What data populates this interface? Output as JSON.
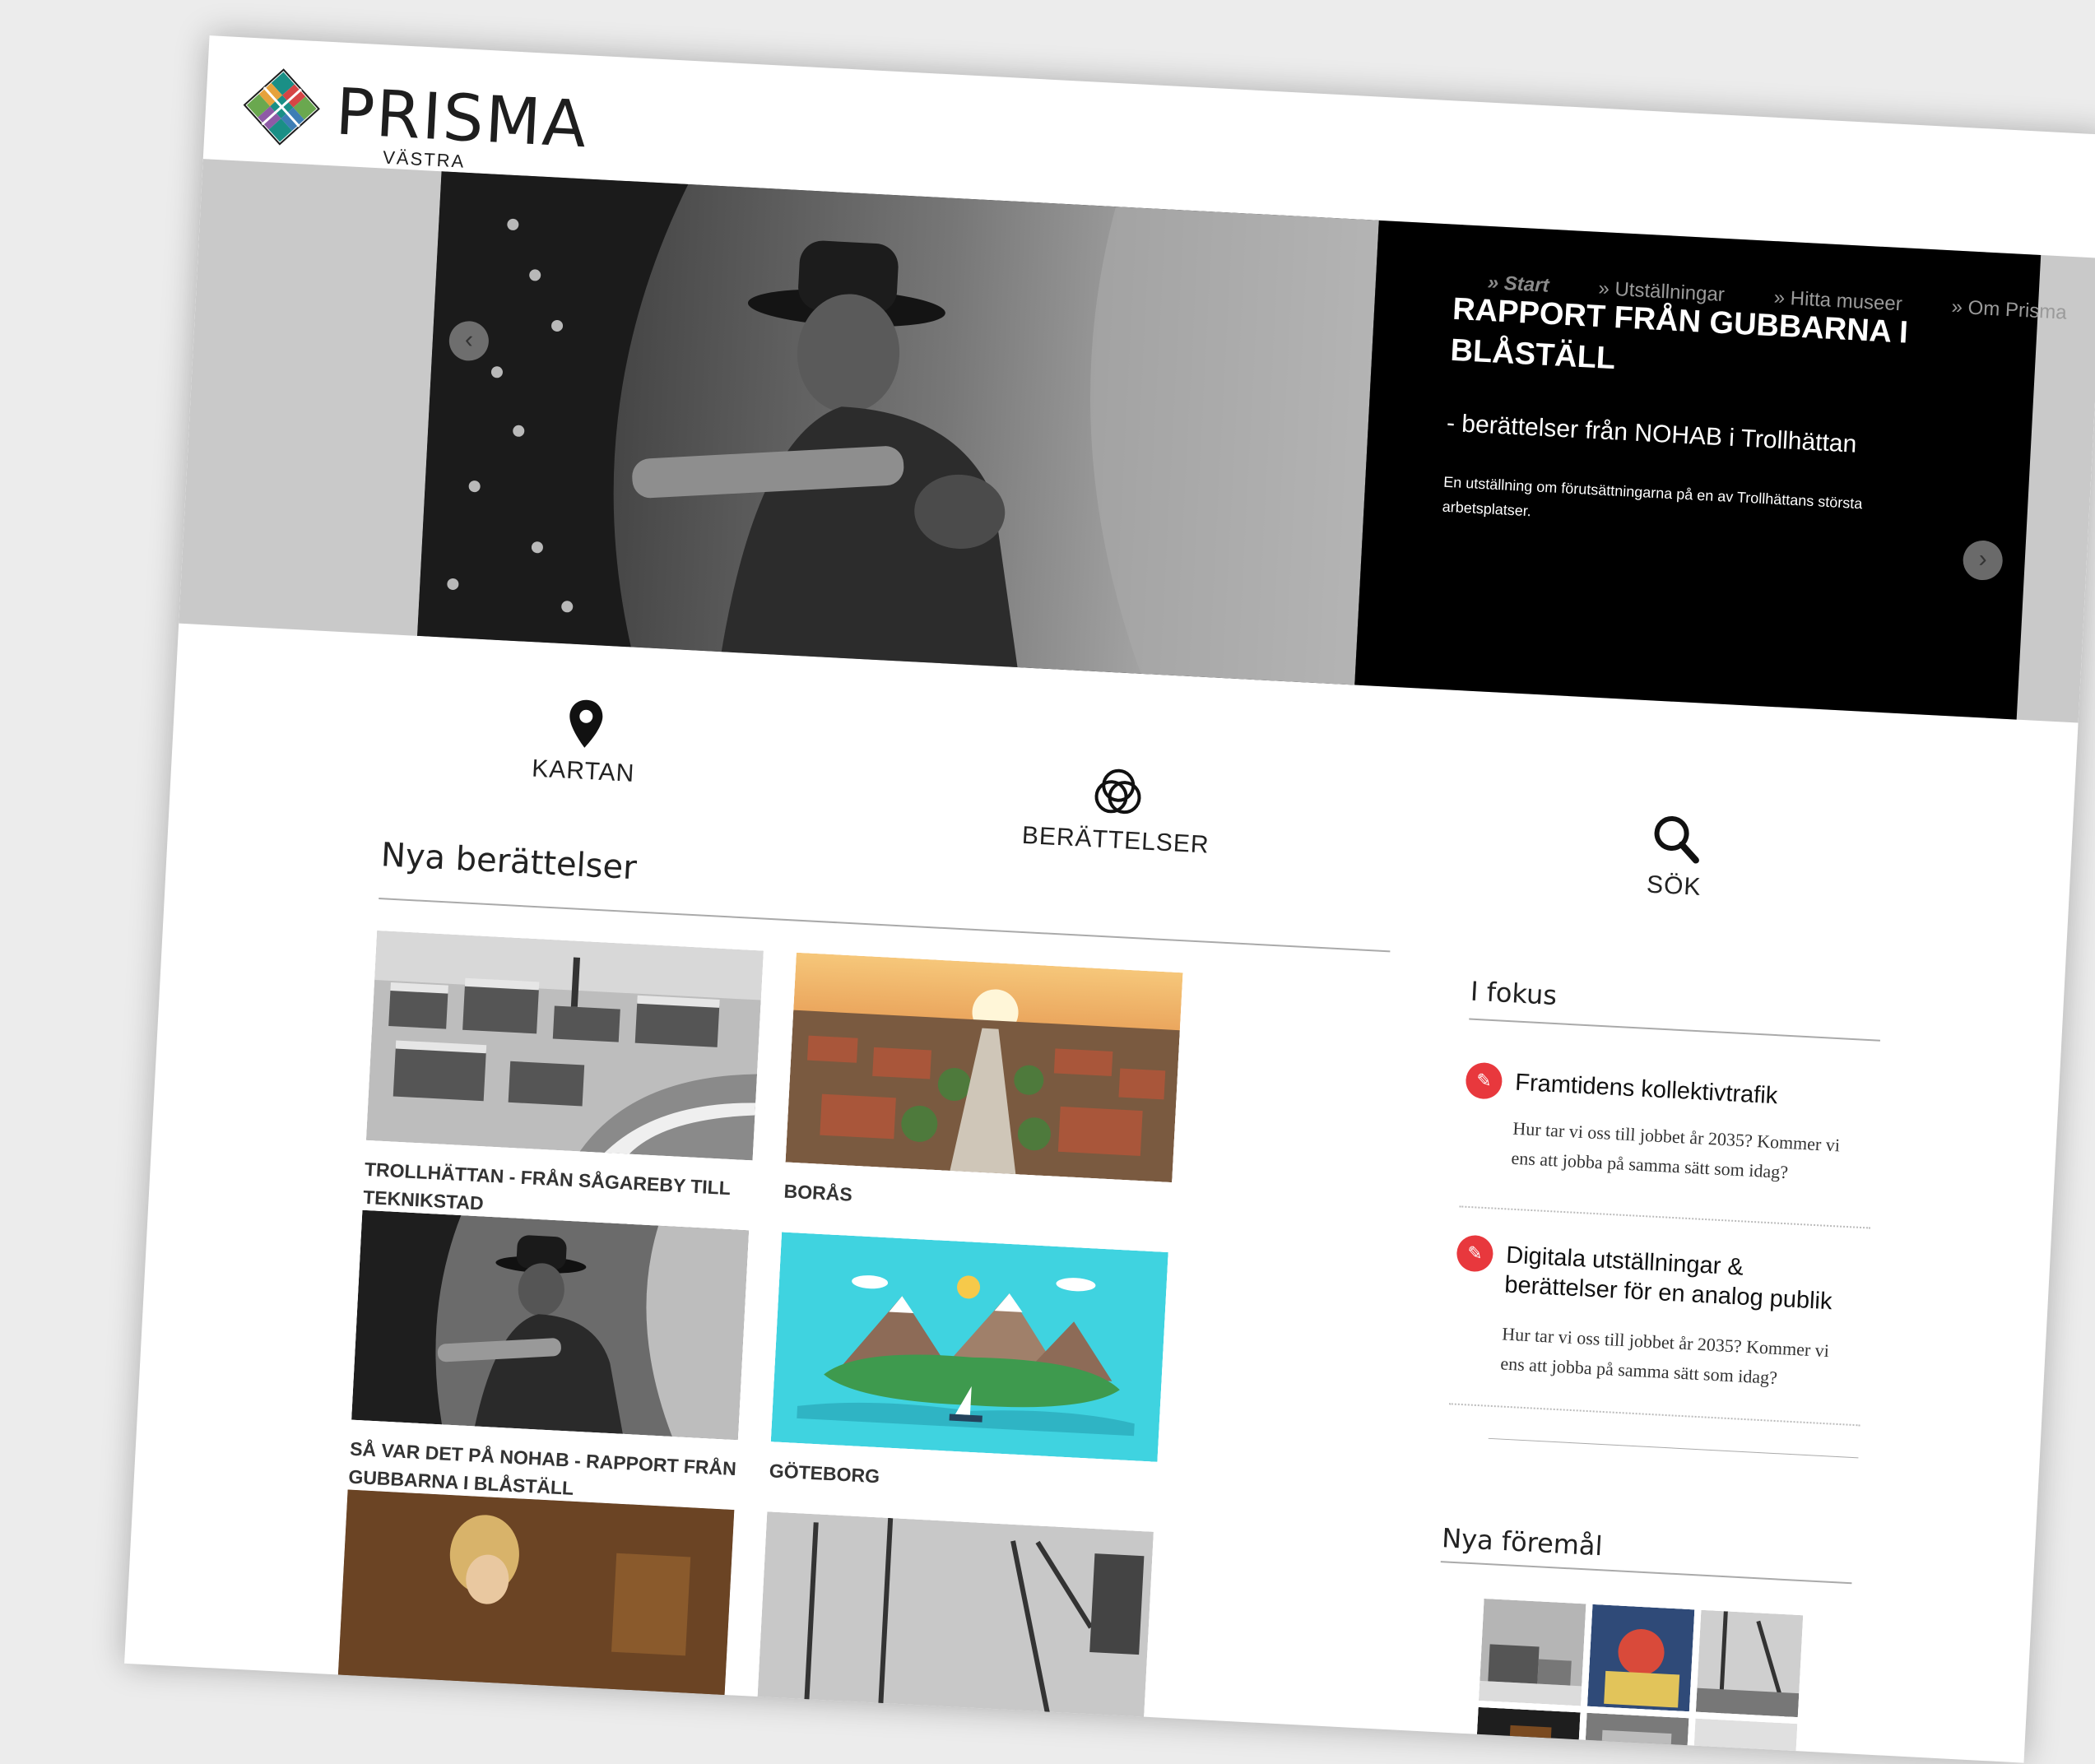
{
  "brand": {
    "name": "PRISMA",
    "subtitle": "VÄSTRA GÖTALAND"
  },
  "nav": [
    "» Start",
    "» Utställningar",
    "» Hitta museer",
    "» Om Prisma"
  ],
  "hero": {
    "title": "RAPPORT FRÅN GUBBARNA I BLÅSTÄLL",
    "subtitle": "- berättelser från NOHAB i Trollhättan",
    "description": "En utställning om förutsättningarna på en av Trollhättans största arbetsplatser."
  },
  "quick_links": {
    "map": "KARTAN",
    "stories": "BERÄTTELSER",
    "search": "SÖK"
  },
  "new_stories": {
    "heading": "Nya berättelser",
    "items": [
      {
        "title": "TROLLHÄTTAN - FRÅN SÅGAREBY TILL TEKNIKSTAD"
      },
      {
        "title": "BORÅS"
      },
      {
        "title": "SÅ VAR DET PÅ NOHAB - RAPPORT FRÅN GUBBARNA I BLÅSTÄLL"
      },
      {
        "title": "GÖTEBORG"
      }
    ]
  },
  "focus": {
    "heading": "I fokus",
    "items": [
      {
        "title": "Framtidens kollektivtrafik",
        "text": "Hur tar vi oss till jobbet år 2035? Kommer vi ens att jobba på samma sätt som idag?"
      },
      {
        "title": "Digitala utställningar & berättelser för en analog publik",
        "text": "Hur tar vi oss till jobbet år 2035? Kommer vi ens att jobba på samma sätt som idag?"
      }
    ]
  },
  "new_objects": {
    "heading": "Nya föremål"
  },
  "colors": {
    "accent": "#e8383d",
    "caption_bg": "#000000",
    "logo_teal": "#1a8f86"
  }
}
